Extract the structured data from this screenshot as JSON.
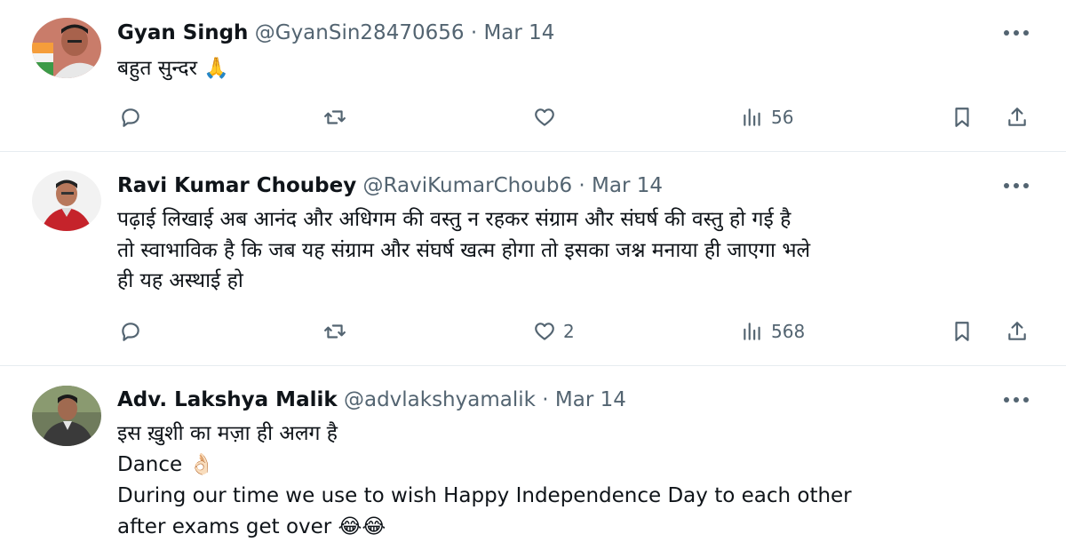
{
  "tweets": [
    {
      "name": "Gyan Singh",
      "handle": "@GyanSin28470656",
      "separator": "·",
      "date": "Mar 14",
      "lines": [
        "बहुत सुन्दर 🙏"
      ],
      "actions": {
        "replies": "",
        "retweets": "",
        "likes": "",
        "views": "56"
      }
    },
    {
      "name": "Ravi Kumar Choubey",
      "handle": "@RaviKumarChoub6",
      "separator": "·",
      "date": "Mar 14",
      "lines": [
        "पढ़ाई लिखाई अब आनंद और अधिगम की वस्तु न रहकर संग्राम और संघर्ष की वस्तु हो गई है",
        "तो स्वाभाविक है कि जब यह संग्राम और संघर्ष खत्म होगा तो इसका जश्न मनाया ही जाएगा भले",
        "ही यह अस्थाई हो"
      ],
      "actions": {
        "replies": "",
        "retweets": "",
        "likes": "2",
        "views": "568"
      }
    },
    {
      "name": "Adv. Lakshya Malik",
      "handle": "@advlakshyamalik",
      "separator": "·",
      "date": "Mar 14",
      "lines": [
        "इस ख़ुशी का मज़ा ही अलग है",
        "Dance 👌🏻",
        "During our time we use to wish Happy Independence Day to each other",
        "after exams get over 😂😂"
      ]
    }
  ],
  "icons": {
    "more": "more-icon",
    "reply": "reply-icon",
    "retweet": "retweet-icon",
    "like": "heart-icon",
    "views": "views-icon",
    "bookmark": "bookmark-icon",
    "share": "share-icon"
  },
  "colors": {
    "text": "#0f1419",
    "secondary": "#536471",
    "divider": "#e6ecf0"
  }
}
